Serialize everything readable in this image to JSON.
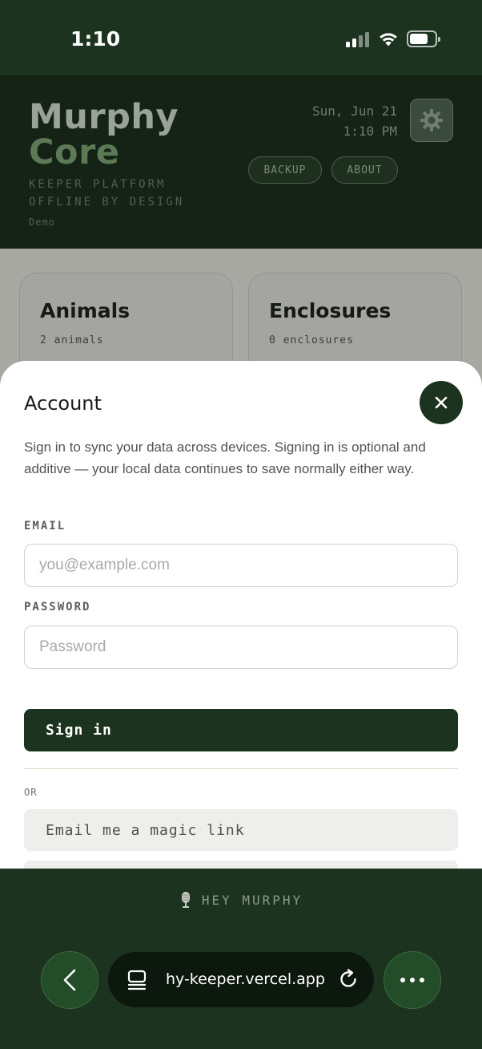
{
  "status_bar": {
    "time": "1:10"
  },
  "header": {
    "brand_line1": "Murphy",
    "brand_line2": "Core",
    "tagline1": "KEEPER PLATFORM",
    "tagline2": "OFFLINE BY DESIGN",
    "mode": "Demo",
    "date": "Sun, Jun 21",
    "time": "1:10 PM",
    "backup_label": "BACKUP",
    "about_label": "ABOUT"
  },
  "cards": [
    {
      "title": "Animals",
      "subtitle": "2 animals"
    },
    {
      "title": "Enclosures",
      "subtitle": "0 enclosures"
    }
  ],
  "account_sheet": {
    "title": "Account",
    "description": "Sign in to sync your data across devices. Signing in is optional and additive — your local data continues to save normally either way.",
    "email_label": "EMAIL",
    "email_placeholder": "you@example.com",
    "password_label": "PASSWORD",
    "password_placeholder": "Password",
    "sign_in_label": "Sign in",
    "or_label": "OR",
    "magic_link_label": "Email me a magic link"
  },
  "assistant": {
    "label": "HEY MURPHY"
  },
  "browser": {
    "url": "hy-keeper.vercel.app"
  },
  "colors": {
    "primary": "#1c3320",
    "header_bg": "#142315",
    "accent": "#5d7a56"
  },
  "icons": [
    "gear-icon",
    "close-icon",
    "microphone-icon",
    "back-chevron-icon",
    "tabs-icon",
    "reload-icon",
    "more-icon"
  ]
}
